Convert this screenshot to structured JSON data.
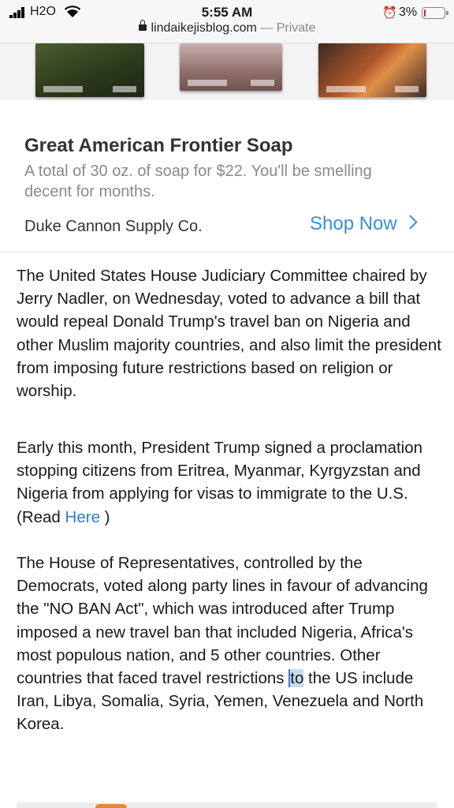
{
  "status_bar": {
    "carrier": "H2O",
    "time": "5:55 AM",
    "battery_percent": "3%",
    "battery_level": 0.03
  },
  "url_bar": {
    "domain": "lindaikejisblog.com",
    "privacy": "— Private"
  },
  "ad": {
    "title": "Great American Frontier Soap",
    "description": "A total of 30 oz. of soap for $22. You'll be smelling decent for months.",
    "advertiser": "Duke Cannon Supply Co.",
    "cta": "Shop Now"
  },
  "article": {
    "paragraph1": "The United States House Judiciary Committee chaired by Jerry Nadler, on Wednesday, voted to advance a bill that would repeal Donald Trump's travel ban on Nigeria and other Muslim majority countries, and also limit the president from imposing future restrictions based on religion or worship.",
    "paragraph2_text": "Early this month, President Trump signed a proclamation stopping citizens from Eritrea, Myanmar, Kyrgyzstan and Nigeria from applying for visas to immigrate to the U.S. (Read ",
    "paragraph2_link": "Here",
    "paragraph2_end": " )",
    "paragraph3_before": "The House of Representatives, controlled by the Democrats, voted along party lines in favour of advancing the \"NO BAN Act\", which was introduced after Trump imposed a new travel ban that included Nigeria, Africa's most populous nation, and 5 other countries. Other countries that faced travel restrictions ",
    "paragraph3_selected": "to",
    "paragraph3_after": " the US include Iran, Libya, Somalia, Syria, Yemen, Venezuela and North Korea."
  },
  "colors": {
    "link": "#2e7cc9",
    "cta": "#3a8fd6",
    "battery_low": "#e02020"
  }
}
